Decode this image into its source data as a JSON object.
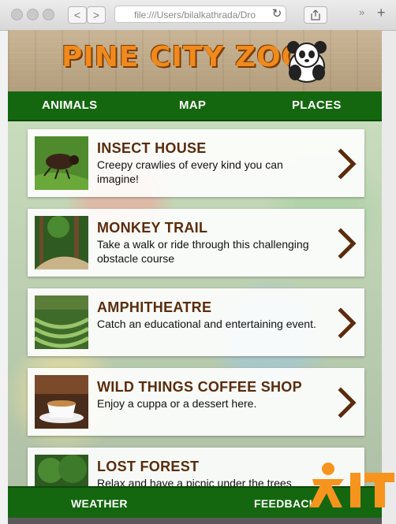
{
  "browser": {
    "address": "file:///Users/bilalkathrada/Dro",
    "back_label": "<",
    "forward_label": ">",
    "more_label": "»",
    "new_tab_label": "+"
  },
  "header": {
    "logo_text": "PINE CITY ZOO"
  },
  "top_nav": {
    "animals": "ANIMALS",
    "map": "MAP",
    "places": "PLACES"
  },
  "places": [
    {
      "title": "INSECT HOUSE",
      "description": "Creepy crawlies of every kind you can imagine!"
    },
    {
      "title": "MONKEY TRAIL",
      "description": "Take a walk or ride through this challenging obstacle course"
    },
    {
      "title": "AMPHITHEATRE",
      "description": "Catch an educational and entertaining event."
    },
    {
      "title": "WILD THINGS COFFEE SHOP",
      "description": "Enjoy a cuppa or a dessert here."
    },
    {
      "title": "LOST FOREST",
      "description": "Relax and have a picnic under the trees"
    }
  ],
  "bottom_nav": {
    "weather": "WEATHER",
    "feedback": "FEEDBACK"
  },
  "colors": {
    "nav_green": "#14670f",
    "title_brown": "#5a2c0d",
    "logo_orange": "#f08a1c"
  }
}
